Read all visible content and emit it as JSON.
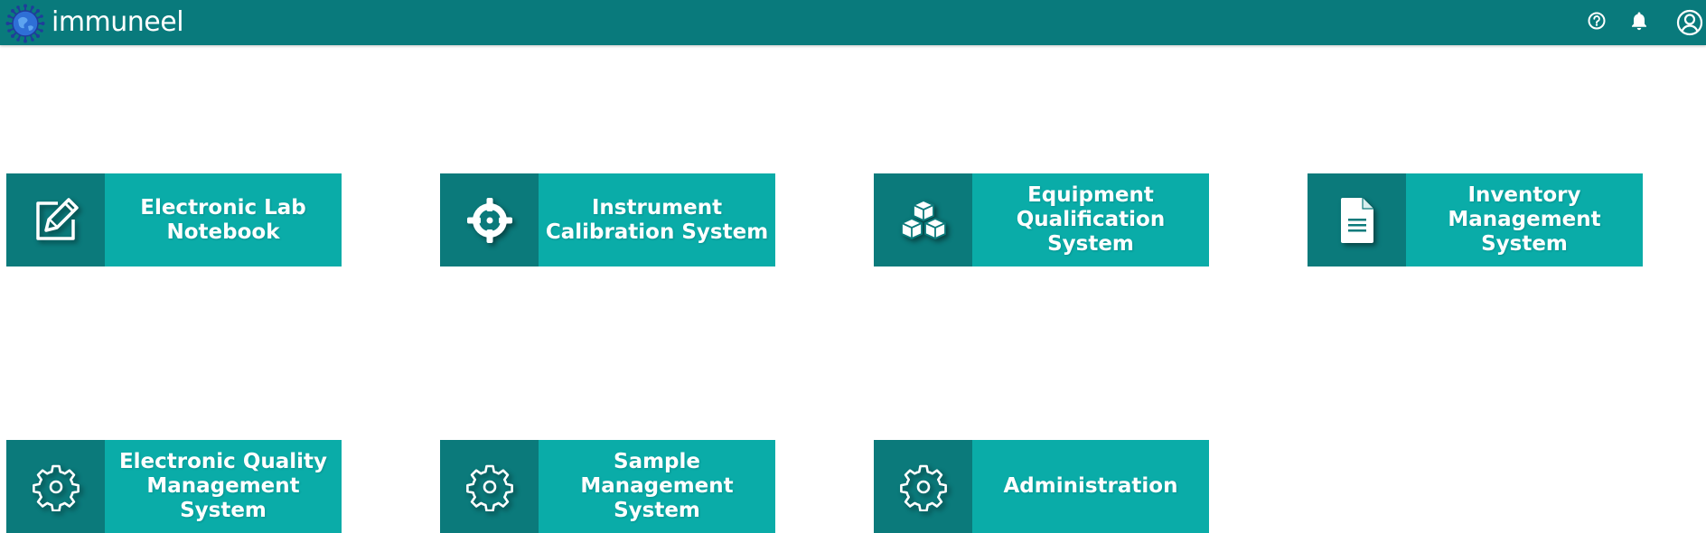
{
  "header": {
    "brand": "immuneel",
    "icons": {
      "logo": "virus-globe-logo-icon",
      "help": "help-circle-icon",
      "notifications": "bell-icon",
      "profile": "user-circle-icon"
    }
  },
  "colors": {
    "topbar": "#097a7c",
    "card_label_bg": "#0aaca8",
    "card_icon_bg": "#0b7a7b",
    "text": "#ffffff"
  },
  "modules": [
    {
      "id": "eln",
      "icon": "edit-square-icon",
      "label_lines": [
        "Electronic Lab",
        "Notebook"
      ]
    },
    {
      "id": "ics",
      "icon": "crosshair-icon",
      "label_lines": [
        "Instrument",
        "Calibration System"
      ]
    },
    {
      "id": "eqs",
      "icon": "cubes-icon",
      "label_lines": [
        "Equipment",
        "Qualification",
        "System"
      ]
    },
    {
      "id": "ims",
      "icon": "document-icon",
      "label_lines": [
        "Inventory",
        "Management",
        "System"
      ]
    },
    {
      "id": "eqms",
      "icon": "gear-icon",
      "label_lines": [
        "Electronic Quality",
        "Management",
        "System"
      ]
    },
    {
      "id": "sms",
      "icon": "gear-icon",
      "label_lines": [
        "Sample",
        "Management",
        "System"
      ]
    },
    {
      "id": "adm",
      "icon": "gear-icon",
      "label_lines": [
        "Administration"
      ]
    }
  ]
}
